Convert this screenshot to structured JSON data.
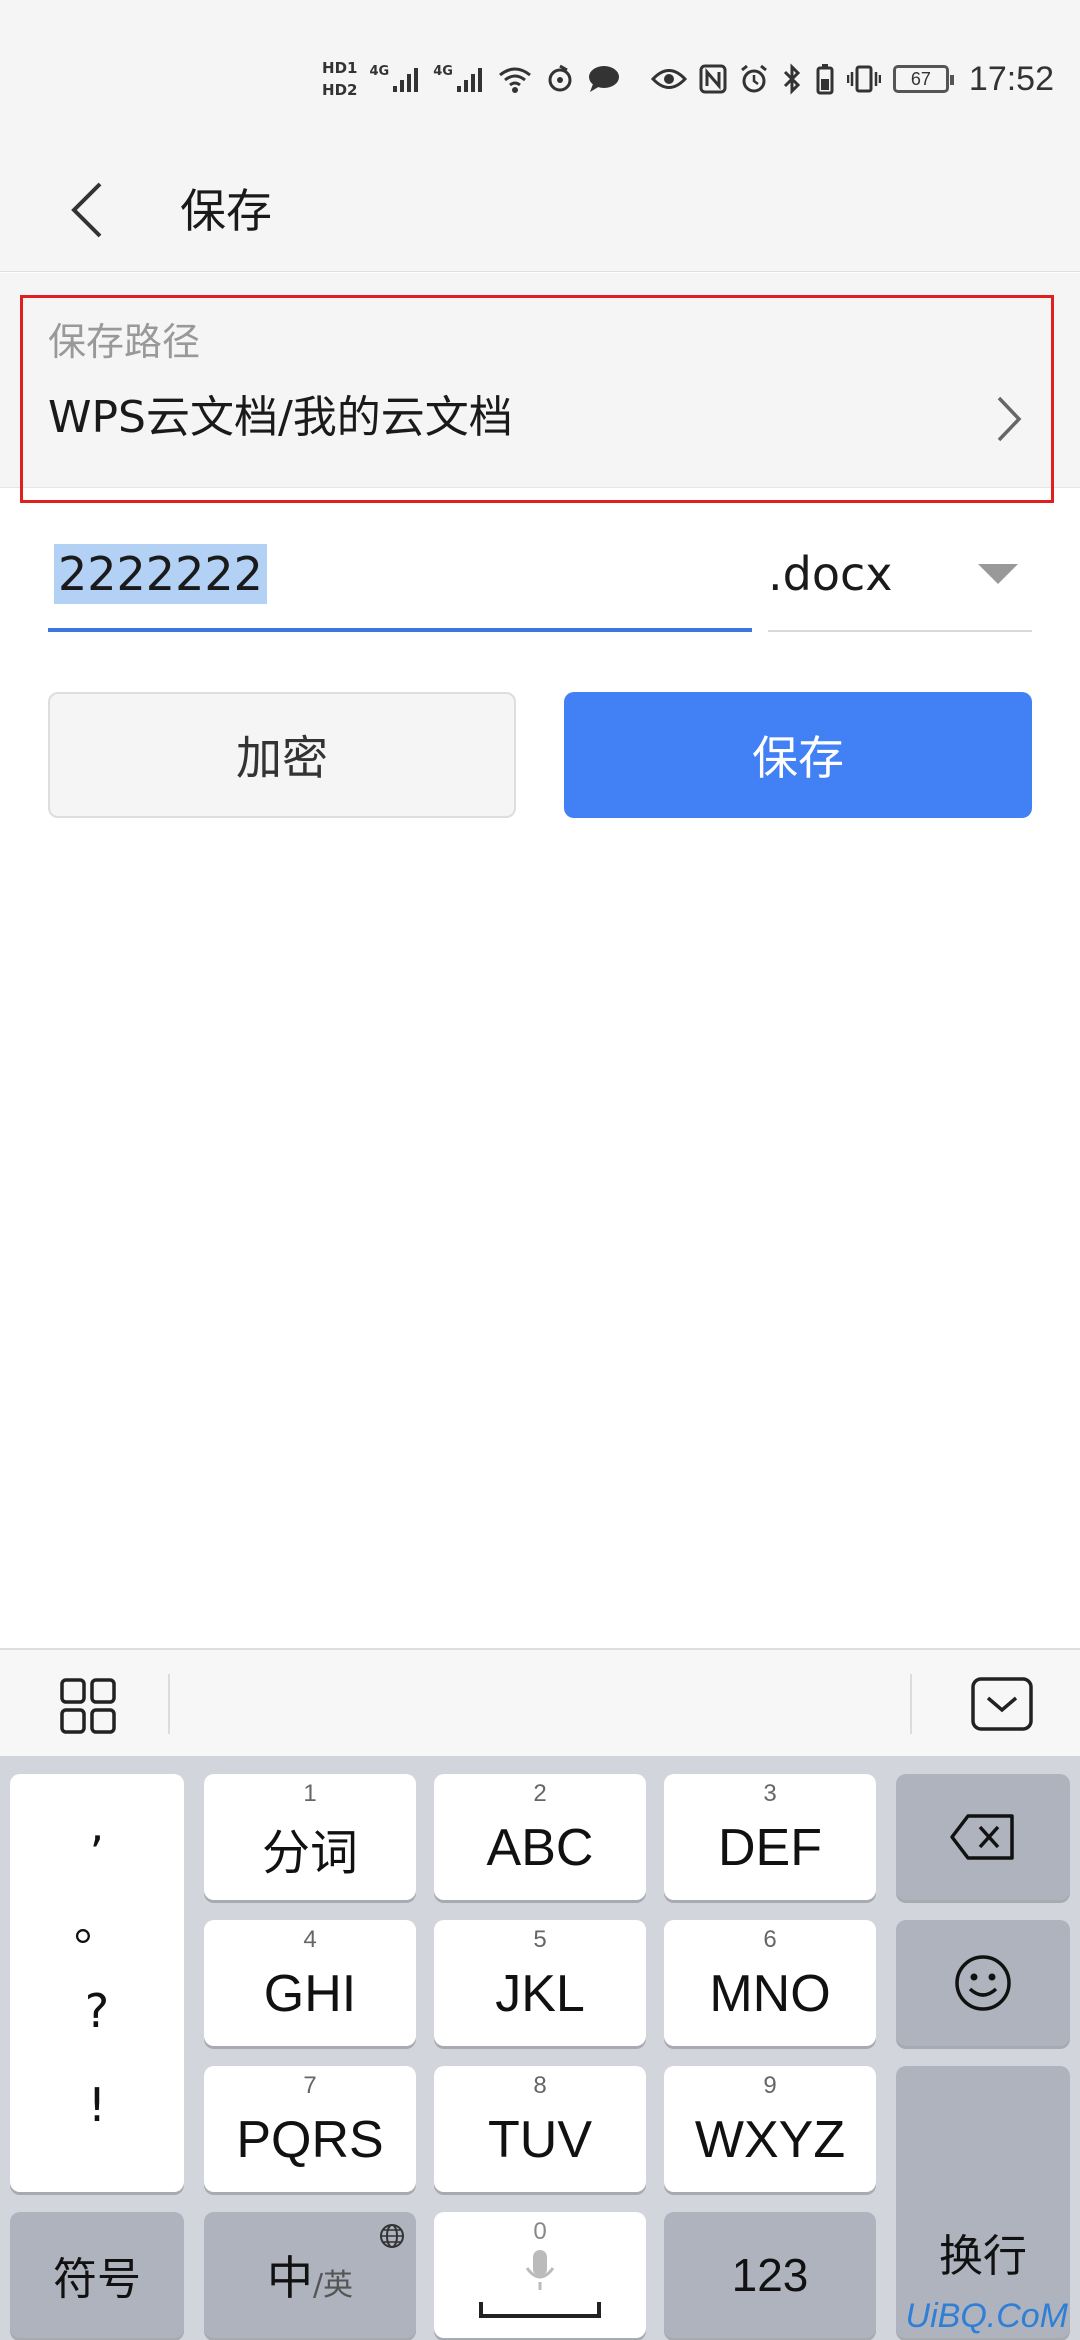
{
  "status_bar": {
    "hd1": "HD1",
    "hd2": "HD2",
    "net1": "4G",
    "net2": "4G",
    "battery": "67",
    "time": "17:52"
  },
  "header": {
    "title": "保存"
  },
  "save_path": {
    "label": "保存路径",
    "value": "WPS云文档/我的云文档"
  },
  "filename": {
    "value": "2222222",
    "extension": ".docx"
  },
  "actions": {
    "encrypt_label": "加密",
    "save_label": "保存"
  },
  "keyboard": {
    "punctuation": [
      ",",
      "。",
      "?",
      "!"
    ],
    "keys": [
      {
        "num": "1",
        "label": "分词"
      },
      {
        "num": "2",
        "label": "ABC"
      },
      {
        "num": "3",
        "label": "DEF"
      },
      {
        "num": "4",
        "label": "GHI"
      },
      {
        "num": "5",
        "label": "JKL"
      },
      {
        "num": "6",
        "label": "MNO"
      },
      {
        "num": "7",
        "label": "PQRS"
      },
      {
        "num": "8",
        "label": "TUV"
      },
      {
        "num": "9",
        "label": "WXYZ"
      }
    ],
    "symbols_label": "符号",
    "lang_main": "中",
    "lang_sub": "/英",
    "space_num": "0",
    "num_label": "123",
    "enter_label": "换行"
  },
  "watermark": "UiBQ.CoM",
  "colors": {
    "accent": "#4180f5",
    "highlight_border": "#e02020",
    "selection": "#b3d0f5"
  }
}
